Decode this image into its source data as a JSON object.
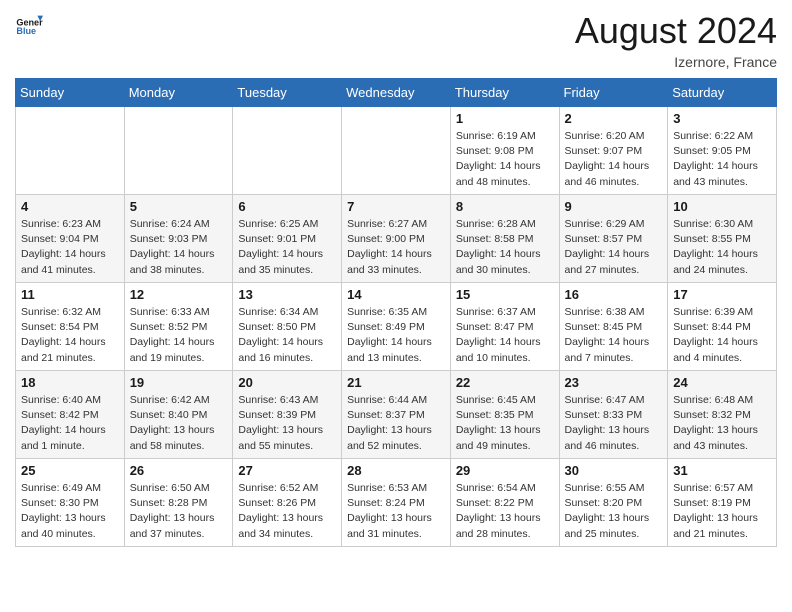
{
  "header": {
    "logo_line1": "General",
    "logo_line2": "Blue",
    "month_title": "August 2024",
    "location": "Izernore, France"
  },
  "weekdays": [
    "Sunday",
    "Monday",
    "Tuesday",
    "Wednesday",
    "Thursday",
    "Friday",
    "Saturday"
  ],
  "weeks": [
    [
      {
        "day": "",
        "info": ""
      },
      {
        "day": "",
        "info": ""
      },
      {
        "day": "",
        "info": ""
      },
      {
        "day": "",
        "info": ""
      },
      {
        "day": "1",
        "info": "Sunrise: 6:19 AM\nSunset: 9:08 PM\nDaylight: 14 hours\nand 48 minutes."
      },
      {
        "day": "2",
        "info": "Sunrise: 6:20 AM\nSunset: 9:07 PM\nDaylight: 14 hours\nand 46 minutes."
      },
      {
        "day": "3",
        "info": "Sunrise: 6:22 AM\nSunset: 9:05 PM\nDaylight: 14 hours\nand 43 minutes."
      }
    ],
    [
      {
        "day": "4",
        "info": "Sunrise: 6:23 AM\nSunset: 9:04 PM\nDaylight: 14 hours\nand 41 minutes."
      },
      {
        "day": "5",
        "info": "Sunrise: 6:24 AM\nSunset: 9:03 PM\nDaylight: 14 hours\nand 38 minutes."
      },
      {
        "day": "6",
        "info": "Sunrise: 6:25 AM\nSunset: 9:01 PM\nDaylight: 14 hours\nand 35 minutes."
      },
      {
        "day": "7",
        "info": "Sunrise: 6:27 AM\nSunset: 9:00 PM\nDaylight: 14 hours\nand 33 minutes."
      },
      {
        "day": "8",
        "info": "Sunrise: 6:28 AM\nSunset: 8:58 PM\nDaylight: 14 hours\nand 30 minutes."
      },
      {
        "day": "9",
        "info": "Sunrise: 6:29 AM\nSunset: 8:57 PM\nDaylight: 14 hours\nand 27 minutes."
      },
      {
        "day": "10",
        "info": "Sunrise: 6:30 AM\nSunset: 8:55 PM\nDaylight: 14 hours\nand 24 minutes."
      }
    ],
    [
      {
        "day": "11",
        "info": "Sunrise: 6:32 AM\nSunset: 8:54 PM\nDaylight: 14 hours\nand 21 minutes."
      },
      {
        "day": "12",
        "info": "Sunrise: 6:33 AM\nSunset: 8:52 PM\nDaylight: 14 hours\nand 19 minutes."
      },
      {
        "day": "13",
        "info": "Sunrise: 6:34 AM\nSunset: 8:50 PM\nDaylight: 14 hours\nand 16 minutes."
      },
      {
        "day": "14",
        "info": "Sunrise: 6:35 AM\nSunset: 8:49 PM\nDaylight: 14 hours\nand 13 minutes."
      },
      {
        "day": "15",
        "info": "Sunrise: 6:37 AM\nSunset: 8:47 PM\nDaylight: 14 hours\nand 10 minutes."
      },
      {
        "day": "16",
        "info": "Sunrise: 6:38 AM\nSunset: 8:45 PM\nDaylight: 14 hours\nand 7 minutes."
      },
      {
        "day": "17",
        "info": "Sunrise: 6:39 AM\nSunset: 8:44 PM\nDaylight: 14 hours\nand 4 minutes."
      }
    ],
    [
      {
        "day": "18",
        "info": "Sunrise: 6:40 AM\nSunset: 8:42 PM\nDaylight: 14 hours\nand 1 minute."
      },
      {
        "day": "19",
        "info": "Sunrise: 6:42 AM\nSunset: 8:40 PM\nDaylight: 13 hours\nand 58 minutes."
      },
      {
        "day": "20",
        "info": "Sunrise: 6:43 AM\nSunset: 8:39 PM\nDaylight: 13 hours\nand 55 minutes."
      },
      {
        "day": "21",
        "info": "Sunrise: 6:44 AM\nSunset: 8:37 PM\nDaylight: 13 hours\nand 52 minutes."
      },
      {
        "day": "22",
        "info": "Sunrise: 6:45 AM\nSunset: 8:35 PM\nDaylight: 13 hours\nand 49 minutes."
      },
      {
        "day": "23",
        "info": "Sunrise: 6:47 AM\nSunset: 8:33 PM\nDaylight: 13 hours\nand 46 minutes."
      },
      {
        "day": "24",
        "info": "Sunrise: 6:48 AM\nSunset: 8:32 PM\nDaylight: 13 hours\nand 43 minutes."
      }
    ],
    [
      {
        "day": "25",
        "info": "Sunrise: 6:49 AM\nSunset: 8:30 PM\nDaylight: 13 hours\nand 40 minutes."
      },
      {
        "day": "26",
        "info": "Sunrise: 6:50 AM\nSunset: 8:28 PM\nDaylight: 13 hours\nand 37 minutes."
      },
      {
        "day": "27",
        "info": "Sunrise: 6:52 AM\nSunset: 8:26 PM\nDaylight: 13 hours\nand 34 minutes."
      },
      {
        "day": "28",
        "info": "Sunrise: 6:53 AM\nSunset: 8:24 PM\nDaylight: 13 hours\nand 31 minutes."
      },
      {
        "day": "29",
        "info": "Sunrise: 6:54 AM\nSunset: 8:22 PM\nDaylight: 13 hours\nand 28 minutes."
      },
      {
        "day": "30",
        "info": "Sunrise: 6:55 AM\nSunset: 8:20 PM\nDaylight: 13 hours\nand 25 minutes."
      },
      {
        "day": "31",
        "info": "Sunrise: 6:57 AM\nSunset: 8:19 PM\nDaylight: 13 hours\nand 21 minutes."
      }
    ]
  ]
}
